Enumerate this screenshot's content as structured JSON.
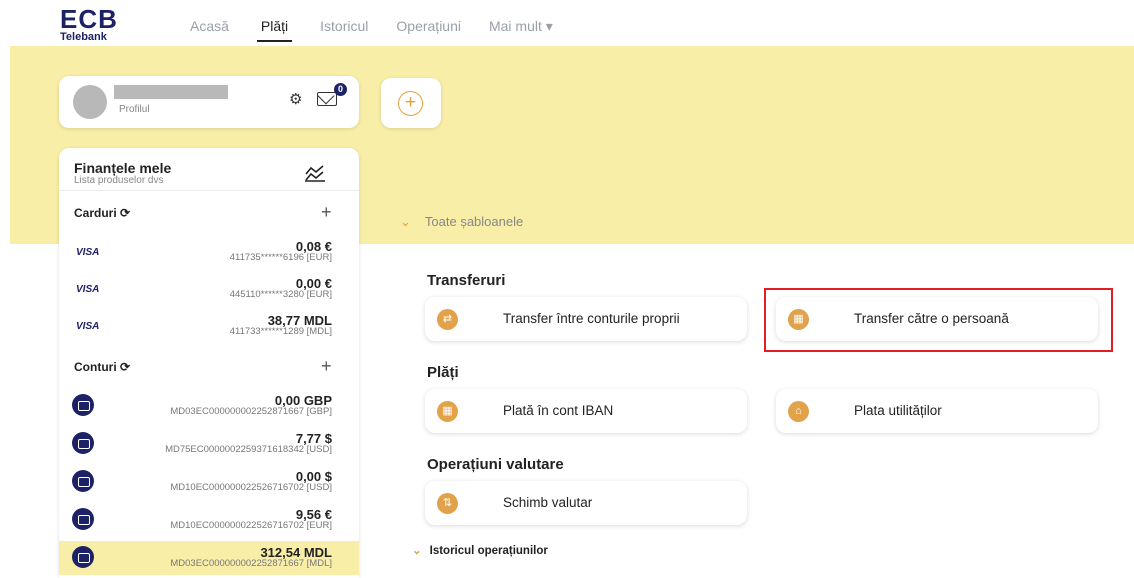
{
  "app": {
    "logo_main": "ECB",
    "logo_sub": "Telebank"
  },
  "nav": [
    {
      "label": "Acasă",
      "active": false
    },
    {
      "label": "Plăți",
      "active": true
    },
    {
      "label": "Istoricul",
      "active": false
    },
    {
      "label": "Operațiuni",
      "active": false
    },
    {
      "label": "Mai mult ▾",
      "active": false
    }
  ],
  "profile": {
    "label": "Profilul",
    "notifications": "0"
  },
  "finance": {
    "title": "Finanțele mele",
    "subtitle": "Lista produselor dvs",
    "cards_title": "Carduri",
    "cards_refresh_icon": "⟳",
    "accounts_title": "Conturi",
    "accounts_refresh_icon": "⟳",
    "add": "+",
    "cards": [
      {
        "brand": "VISA",
        "amount": "0,08 €",
        "number": "411735******6196 [EUR]"
      },
      {
        "brand": "VISA",
        "amount": "0,00 €",
        "number": "445110******3280 [EUR]"
      },
      {
        "brand": "VISA",
        "amount": "38,77 MDL",
        "number": "411733******1289 [MDL]"
      }
    ],
    "accounts": [
      {
        "amount": "0,00 GBP",
        "number": "MD03EC000000002252871667 [GBP]"
      },
      {
        "amount": "7,77 $",
        "number": "MD75EC000000225937161834‌2 [USD]"
      },
      {
        "amount": "0,00 $",
        "number": "MD10EC000000022526716702 [USD]"
      },
      {
        "amount": "9,56 €",
        "number": "MD10EC000000022526716702 [EUR]"
      },
      {
        "amount": "312,54 MDL",
        "number": "MD03EC000000002252871667 [MDL]"
      }
    ]
  },
  "templates_label": "Toate șabloanele",
  "groups": {
    "transfers": "Transferuri",
    "payments": "Plăți",
    "fx": "Operațiuni valutare"
  },
  "operations": {
    "own_transfer": "Transfer între conturile proprii",
    "person_transfer": "Transfer către o persoană",
    "iban_payment": "Plată în cont IBAN",
    "utilities": "Plata utilităților",
    "exchange": "Schimb valutar"
  },
  "history_label": "Istoricul operațiunilor",
  "colors": {
    "brand": "#1d2266",
    "accent": "#e2a24a",
    "band": "#f8eea7",
    "highlight": "#e21d24"
  }
}
